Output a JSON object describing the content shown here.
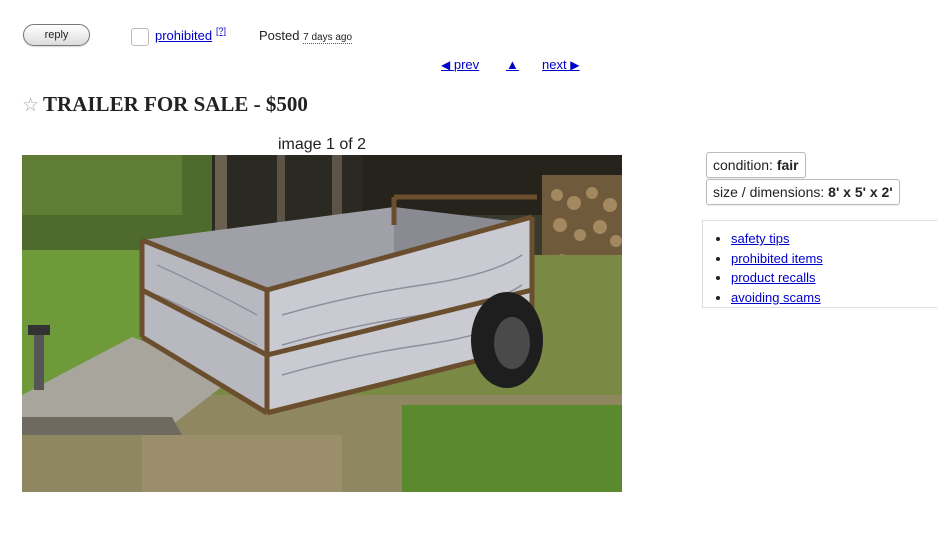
{
  "header": {
    "reply_label": "reply",
    "flag_label": "prohibited",
    "flag_help": "[?]",
    "posted_label": "Posted",
    "posted_ago": "7 days ago"
  },
  "nav": {
    "prev_label": "prev",
    "up_label": "▲",
    "next_label": "next"
  },
  "posting": {
    "star": "☆",
    "title": "TRAILER FOR SALE - $500",
    "image_counter": "image 1 of 2"
  },
  "attributes": [
    {
      "label": "condition:",
      "value": "fair"
    },
    {
      "label": "size / dimensions:",
      "value": "8' x 5' x 2'"
    }
  ],
  "sidebar_links": [
    "safety tips",
    "prohibited items",
    "product recalls",
    "avoiding scams"
  ],
  "colors": {
    "link": "#0000cc"
  }
}
